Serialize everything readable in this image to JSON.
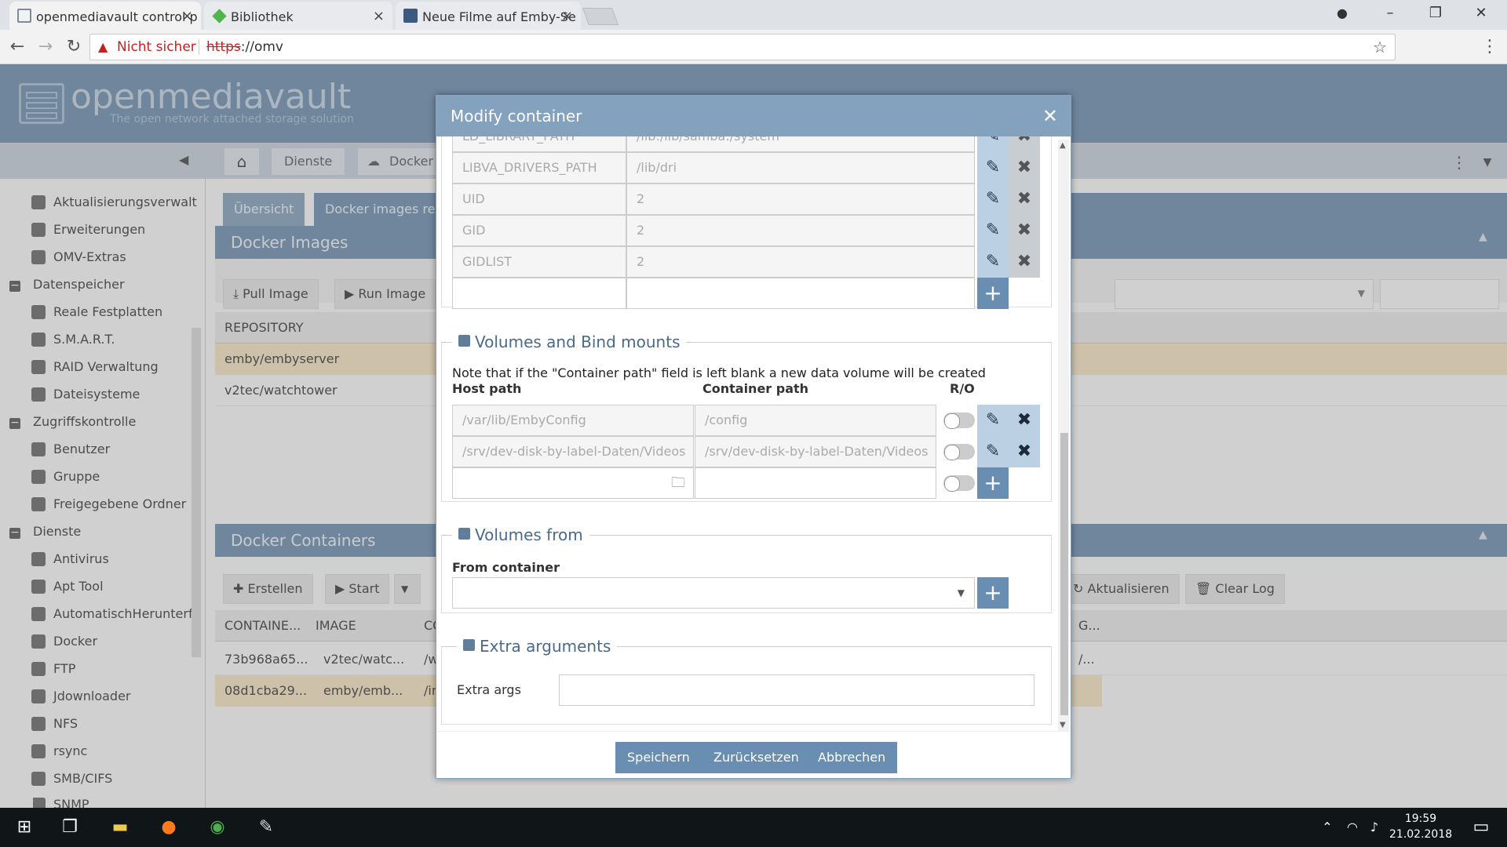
{
  "browser": {
    "tabs": [
      {
        "label": "openmediavault control p"
      },
      {
        "label": "Bibliothek"
      },
      {
        "label": "Neue Filme auf Emby-Se"
      }
    ],
    "insecure_label": "Nicht sicher",
    "url_scheme": "https",
    "url_rest": "://omv"
  },
  "omv": {
    "logo_text": "openmediavault",
    "tagline": "The open network attached storage solution"
  },
  "breadcrumb": [
    "Dienste",
    "Docker"
  ],
  "sidebar": {
    "items": [
      {
        "label": "Aktualisierungsverwalt",
        "type": "item"
      },
      {
        "label": "Erweiterungen",
        "type": "item"
      },
      {
        "label": "OMV-Extras",
        "type": "item"
      },
      {
        "label": "Datenspeicher",
        "type": "group"
      },
      {
        "label": "Reale Festplatten",
        "type": "item"
      },
      {
        "label": "S.M.A.R.T.",
        "type": "item"
      },
      {
        "label": "RAID Verwaltung",
        "type": "item"
      },
      {
        "label": "Dateisysteme",
        "type": "item"
      },
      {
        "label": "Zugriffskontrolle",
        "type": "group"
      },
      {
        "label": "Benutzer",
        "type": "item"
      },
      {
        "label": "Gruppe",
        "type": "item"
      },
      {
        "label": "Freigegebene Ordner",
        "type": "item"
      },
      {
        "label": "Dienste",
        "type": "group"
      },
      {
        "label": "Antivirus",
        "type": "item"
      },
      {
        "label": "Apt Tool",
        "type": "item"
      },
      {
        "label": "AutomatischHerunterf.",
        "type": "item"
      },
      {
        "label": "Docker",
        "type": "item"
      },
      {
        "label": "FTP",
        "type": "item"
      },
      {
        "label": "Jdownloader",
        "type": "item"
      },
      {
        "label": "NFS",
        "type": "item"
      },
      {
        "label": "rsync",
        "type": "item"
      },
      {
        "label": "SMB/CIFS",
        "type": "item"
      },
      {
        "label": "SNMP",
        "type": "item"
      }
    ]
  },
  "main": {
    "tabs": [
      "Übersicht",
      "Docker images repo"
    ],
    "images_panel_title": "Docker Images",
    "pull_image": "Pull Image",
    "run_image": "Run Image",
    "repo_header": "REPOSITORY",
    "repos": [
      "emby/embyserver",
      "v2tec/watchtower"
    ],
    "containers_panel_title": "Docker Containers",
    "erstellen": "Erstellen",
    "start": "Start",
    "aktualisieren": "Aktualisieren",
    "clear_log": "Clear Log",
    "container_headers": [
      "CONTAINE...",
      "IMAGE",
      "CO"
    ],
    "containers": [
      {
        "id": "73b968a65...",
        "image": "v2tec/watc...",
        "cmd": "/w",
        "extra": "/..."
      },
      {
        "id": "08d1cba29...",
        "image": "emby/emb...",
        "cmd": "/in",
        "extra": ""
      }
    ],
    "col_overflow": "G..."
  },
  "modal": {
    "title": "Modify container",
    "env_rows": [
      {
        "name": "LD_LIBRARY_PATH",
        "value": "/lib:/lib/samba:/system"
      },
      {
        "name": "LIBVA_DRIVERS_PATH",
        "value": "/lib/dri"
      },
      {
        "name": "UID",
        "value": "2"
      },
      {
        "name": "GID",
        "value": "2"
      },
      {
        "name": "GIDLIST",
        "value": "2"
      }
    ],
    "volumes_title": "Volumes and Bind mounts",
    "volumes_note": "Note that if the \"Container path\" field is left blank a new data volume will be created",
    "host_path_label": "Host path",
    "container_path_label": "Container path",
    "ro_label": "R/O",
    "volumes": [
      {
        "host": "/var/lib/EmbyConfig",
        "container": "/config"
      },
      {
        "host": "/srv/dev-disk-by-label-Daten/Videos",
        "container": "/srv/dev-disk-by-label-Daten/Videos"
      }
    ],
    "volumes_from_title": "Volumes from",
    "from_container_label": "From container",
    "extra_args_title": "Extra arguments",
    "extra_args_label": "Extra args",
    "save": "Speichern",
    "reset": "Zurücksetzen",
    "cancel": "Abbrechen"
  },
  "taskbar": {
    "time": "19:59",
    "date": "21.02.2018"
  },
  "colors": {
    "header_blue": "#6a8eb1",
    "modal_head": "#84a1bd",
    "selected_row": "#fbe9c4"
  }
}
